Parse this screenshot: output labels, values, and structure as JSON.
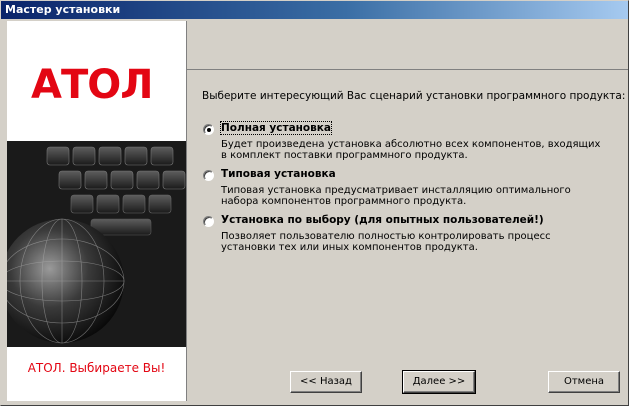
{
  "window": {
    "title": "Мастер установки"
  },
  "sidebar": {
    "logo_text": "АТОЛ",
    "slogan": "АТОЛ. Выбираете Вы!",
    "colors": {
      "brand_red": "#e30613"
    }
  },
  "main": {
    "prompt": "Выберите интересующий Вас сценарий установки программного продукта:",
    "options": [
      {
        "label": "Полная установка",
        "description": "Будет произведена установка абсолютно всех компонентов, входящих в комплект поставки программного продукта.",
        "selected": true
      },
      {
        "label": "Типовая установка",
        "description": "Типовая установка предусматривает инсталляцию оптимального набора компонентов программного продукта.",
        "selected": false
      },
      {
        "label": "Установка по выбору (для опытных пользователей!)",
        "description": "Позволяет пользователю полностью контролировать процесс установки тех или иных компонентов продукта.",
        "selected": false
      }
    ]
  },
  "buttons": {
    "back": "<< Назад",
    "next": "Далее >>",
    "cancel": "Отмена"
  }
}
